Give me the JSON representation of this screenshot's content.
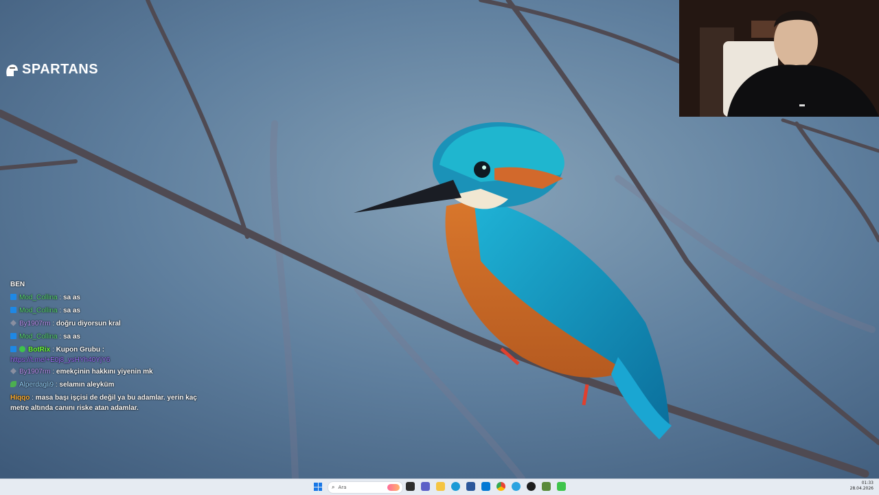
{
  "logo": {
    "text": "SPARTANS"
  },
  "chat": {
    "header": "BEN",
    "messages": [
      {
        "badge": "mod",
        "user": "Mod_Collina",
        "color": "#5ee07a",
        "text": "sa as"
      },
      {
        "badge": "mod",
        "user": "Mod_Collina",
        "color": "#5ee07a",
        "text": "sa as"
      },
      {
        "badge": "gift",
        "user": "By1907rm",
        "color": "#c69bff",
        "text": "doğru diyorsun kral"
      },
      {
        "badge": "mod",
        "user": "Mod_Collina",
        "color": "#5ee07a",
        "text": "sa as"
      },
      {
        "badge": "bot",
        "user": "BotRix",
        "color": "#6dff3a",
        "text": "Kupon Grubu :",
        "link": "https://t.me/+E0j8_ysHYh40YjY6"
      },
      {
        "badge": "gift",
        "user": "By1907rm",
        "color": "#c69bff",
        "text": "emekçinin hakkını yiyenin mk"
      },
      {
        "badge": "leaf",
        "user": "Alperdagli9",
        "color": "#9ad6ff",
        "text": "selamın aleyküm"
      },
      {
        "badge": "none",
        "user": "Hiqqo",
        "color": "#ffae2e",
        "text": "masa başı işçisi de değil ya bu adamlar. yerin kaç metre altında canını riske atan adamlar."
      }
    ]
  },
  "taskbar": {
    "search_placeholder": "Ara",
    "time": "01:33",
    "date": "28.04.2026",
    "icons": [
      "files-icon",
      "widgets-icon",
      "teams-icon",
      "file-explorer-icon",
      "edge-icon",
      "store-icon",
      "mail-icon",
      "chrome-icon",
      "telegram-icon",
      "media-icon",
      "minecraft-icon",
      "app-icon"
    ]
  }
}
